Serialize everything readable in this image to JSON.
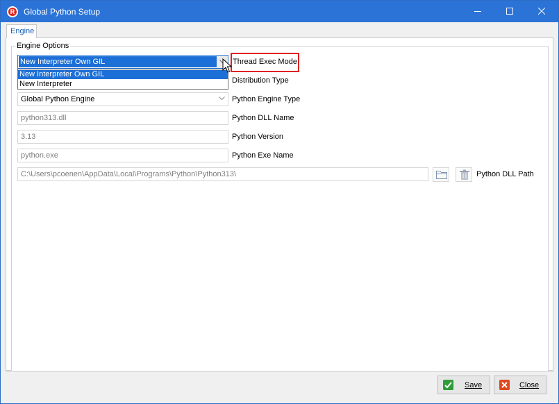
{
  "window": {
    "title": "Global Python Setup"
  },
  "tabs": [
    {
      "label": "Engine"
    }
  ],
  "group": {
    "label": "Engine Options"
  },
  "thread_exec": {
    "value": "New Interpreter Own GIL",
    "label": "Thread Exec Mode",
    "options": [
      "New Interpreter Own GIL",
      "New Interpreter"
    ]
  },
  "distribution": {
    "label": "Distribution Type"
  },
  "engine_type": {
    "value": "Global Python Engine",
    "label": "Python Engine Type"
  },
  "dll_name": {
    "value": "python313.dll",
    "label": "Python DLL Name"
  },
  "version": {
    "value": "3.13",
    "label": "Python Version"
  },
  "exe_name": {
    "value": "python.exe",
    "label": "Python Exe Name"
  },
  "dll_path": {
    "value": "C:\\Users\\pcoenen\\AppData\\Local\\Programs\\Python\\Python313\\",
    "label": "Python DLL Path"
  },
  "buttons": {
    "save": "Save",
    "close": "Close"
  },
  "icons": {
    "app": "app-logo-icon",
    "minimize": "minimize-icon",
    "maximize": "maximize-icon",
    "close": "close-icon",
    "folder": "folder-icon",
    "trash": "trash-icon",
    "checkmark": "checkmark-icon",
    "cancel": "cancel-icon"
  },
  "colors": {
    "titlebar": "#2b73d6",
    "selection": "#1c6fd6",
    "highlight": "#e02020"
  }
}
